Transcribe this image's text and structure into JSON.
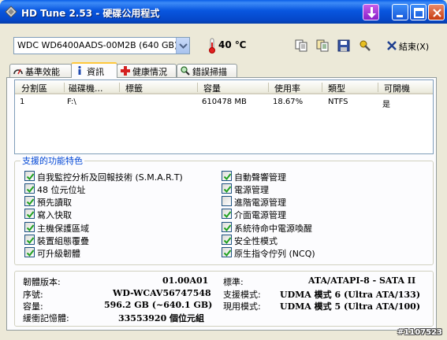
{
  "window": {
    "title": "HD Tune 2.53 - 硬碟公用程式"
  },
  "toolbar": {
    "drive": "WDC WD6400AADS-00M2B (640 GB)",
    "temperature": "40 ℃",
    "exit_label": "結束(X)"
  },
  "tabs": [
    {
      "label": "基準效能",
      "icon": "speedometer-icon"
    },
    {
      "label": "資訊",
      "icon": "info-icon",
      "active": true
    },
    {
      "label": "健康情況",
      "icon": "health-cross-icon"
    },
    {
      "label": "錯誤掃描",
      "icon": "magnifier-icon"
    }
  ],
  "partitions": {
    "columns": [
      "分割區",
      "磁碟機...",
      "標籤",
      "容量",
      "使用率",
      "類型",
      "可開機"
    ],
    "rows": [
      [
        "1",
        "F:\\",
        "",
        "610478 MB",
        "18.67%",
        "NTFS",
        "是"
      ]
    ]
  },
  "features": {
    "title": "支援的功能特色",
    "left": [
      {
        "label": "自我監控分析及回報技術 (S.M.A.R.T)",
        "checked": true
      },
      {
        "label": "48 位元位址",
        "checked": true
      },
      {
        "label": "預先讀取",
        "checked": true
      },
      {
        "label": "寫入快取",
        "checked": true
      },
      {
        "label": "主機保護區域",
        "checked": true
      },
      {
        "label": "裝置組態覆疊",
        "checked": true
      },
      {
        "label": "可升級韌體",
        "checked": true
      }
    ],
    "right": [
      {
        "label": "自動聲響管理",
        "checked": true
      },
      {
        "label": "電源管理",
        "checked": true
      },
      {
        "label": "進階電源管理",
        "checked": false
      },
      {
        "label": "介面電源管理",
        "checked": true
      },
      {
        "label": "系統待命中電源喚醒",
        "checked": true
      },
      {
        "label": "安全性模式",
        "checked": true
      },
      {
        "label": "原生指令佇列 (NCQ)",
        "checked": true
      }
    ]
  },
  "info": {
    "firmware_label": "韌體版本:",
    "firmware": "01.00A01",
    "serial_label": "序號:",
    "serial": "WD-WCAV56747548",
    "capacity_label": "容量:",
    "capacity": "596.2 GB (~640.1 GB)",
    "buffer_label": "緩衝記憶體:",
    "buffer": "33553920 個位元組",
    "standard_label": "標準:",
    "standard": "ATA/ATAPI-8 - SATA II",
    "supported_label": "支援模式:",
    "supported": "UDMA 模式 6 (Ultra ATA/133)",
    "current_label": "現用模式:",
    "current": "UDMA 模式 5 (Ultra ATA/100)"
  },
  "watermark": "#1107523"
}
